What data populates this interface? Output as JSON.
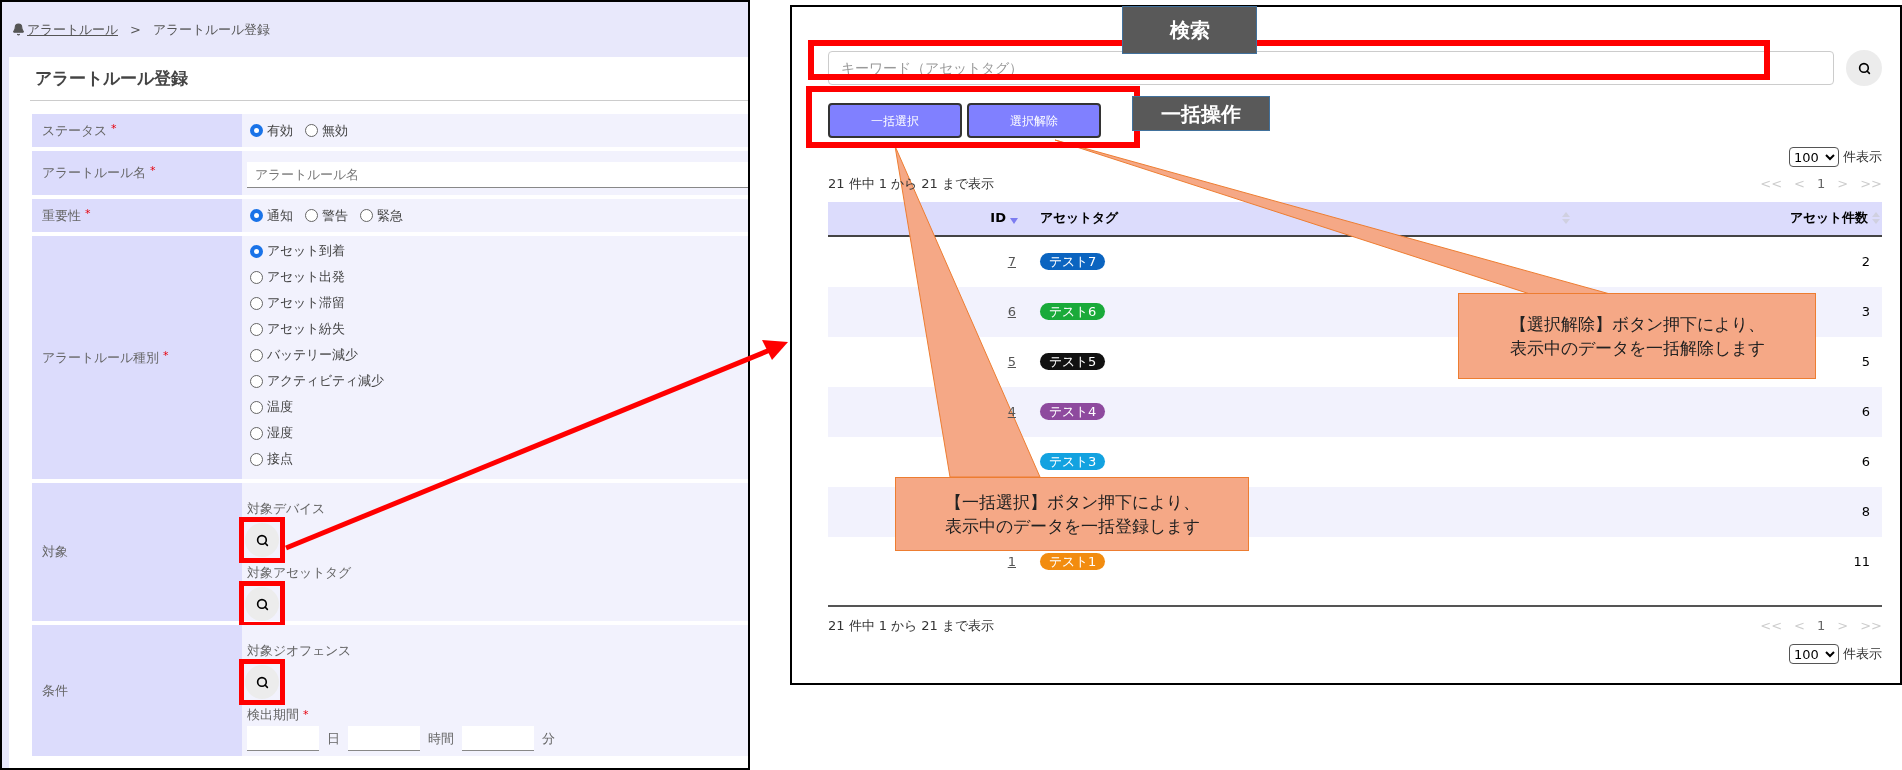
{
  "left_screen": {
    "breadcrumb": {
      "parent": "アラートルール",
      "separator": ">",
      "current": "アラートルール登録"
    },
    "title": "アラートルール登録",
    "form_rows": [
      {
        "kind": "radio",
        "label": "ステータス",
        "required_mark": "*",
        "options": [
          {
            "label": "有効",
            "selected": true
          },
          {
            "label": "無効",
            "selected": false
          }
        ]
      },
      {
        "kind": "text",
        "label": "アラートルール名",
        "required_mark": "*",
        "placeholder": "アラートルール名"
      },
      {
        "kind": "radio",
        "label": "重要性",
        "required_mark": "*",
        "options": [
          {
            "label": "通知",
            "selected": true
          },
          {
            "label": "警告",
            "selected": false
          },
          {
            "label": "緊急",
            "selected": false
          }
        ]
      },
      {
        "kind": "radio_list",
        "label": "アラートルール種別",
        "required_mark": "*",
        "options": [
          {
            "label": "アセット到着",
            "selected": true
          },
          {
            "label": "アセット出発",
            "selected": false
          },
          {
            "label": "アセット滞留",
            "selected": false
          },
          {
            "label": "アセット紛失",
            "selected": false
          },
          {
            "label": "バッテリー減少",
            "selected": false
          },
          {
            "label": "アクティビティ減少",
            "selected": false
          },
          {
            "label": "温度",
            "selected": false
          },
          {
            "label": "湿度",
            "selected": false
          },
          {
            "label": "接点",
            "selected": false
          }
        ]
      },
      {
        "kind": "pickers",
        "label": "対象",
        "pickers": [
          {
            "label": "対象デバイス"
          },
          {
            "label": "対象アセットタグ"
          }
        ]
      },
      {
        "kind": "condition",
        "label": "条件",
        "pickers": [
          {
            "label": "対象ジオフェンス"
          }
        ],
        "duration_label": "検出期間",
        "duration_mark": "*",
        "duration_units": [
          "日",
          "時間",
          "分"
        ]
      }
    ]
  },
  "right_screen": {
    "search": {
      "placeholder": "キーワード（アセットタグ）"
    },
    "bulk_buttons": [
      "一括選択",
      "選択解除"
    ],
    "page_size": {
      "value": "100",
      "label": "件表示"
    },
    "summary": "21 件中 1 から 21 まで表示",
    "pagination": [
      {
        "label": "<<",
        "disabled": true
      },
      {
        "label": "<",
        "disabled": true
      },
      {
        "label": "1",
        "disabled": false
      },
      {
        "label": ">",
        "disabled": true
      },
      {
        "label": ">>",
        "disabled": true
      }
    ],
    "columns": [
      {
        "label": "ID",
        "sorted": true
      },
      {
        "label": "アセットタグ",
        "sorted": false
      },
      {
        "label": "アセット件数",
        "sorted": false
      }
    ],
    "rows": [
      {
        "id": "7",
        "tag": "テスト7",
        "color": "#0b64c0",
        "count": "2"
      },
      {
        "id": "6",
        "tag": "テスト6",
        "color": "#1aaa3a",
        "count": "3"
      },
      {
        "id": "5",
        "tag": "テスト5",
        "color": "#111111",
        "count": "5"
      },
      {
        "id": "4",
        "tag": "テスト4",
        "color": "#8e4a9e",
        "count": "6"
      },
      {
        "tag": "テスト3",
        "color": "#13a2e0",
        "count": "6"
      },
      {
        "count": "8"
      },
      {
        "id": "1",
        "tag": "テスト1",
        "color": "#f28c0f",
        "count": "11"
      }
    ],
    "footer_summary": "21 件中 1 から 21 まで表示",
    "footer_pagination": [
      {
        "label": "<<",
        "disabled": true
      },
      {
        "label": "<",
        "disabled": true
      },
      {
        "label": "1",
        "disabled": false
      },
      {
        "label": ">",
        "disabled": true
      },
      {
        "label": ">>",
        "disabled": true
      }
    ],
    "footer_page_size": {
      "value": "100",
      "label": "件表示"
    }
  },
  "annotations": {
    "labels": [
      "検索",
      "一括操作"
    ],
    "callouts": [
      {
        "lines": [
          "【選択解除】ボタン押下により、",
          "表示中のデータを一括解除します"
        ]
      },
      {
        "lines": [
          "【一括選択】ボタン押下により、",
          "表示中のデータを一括登録します"
        ]
      }
    ]
  }
}
